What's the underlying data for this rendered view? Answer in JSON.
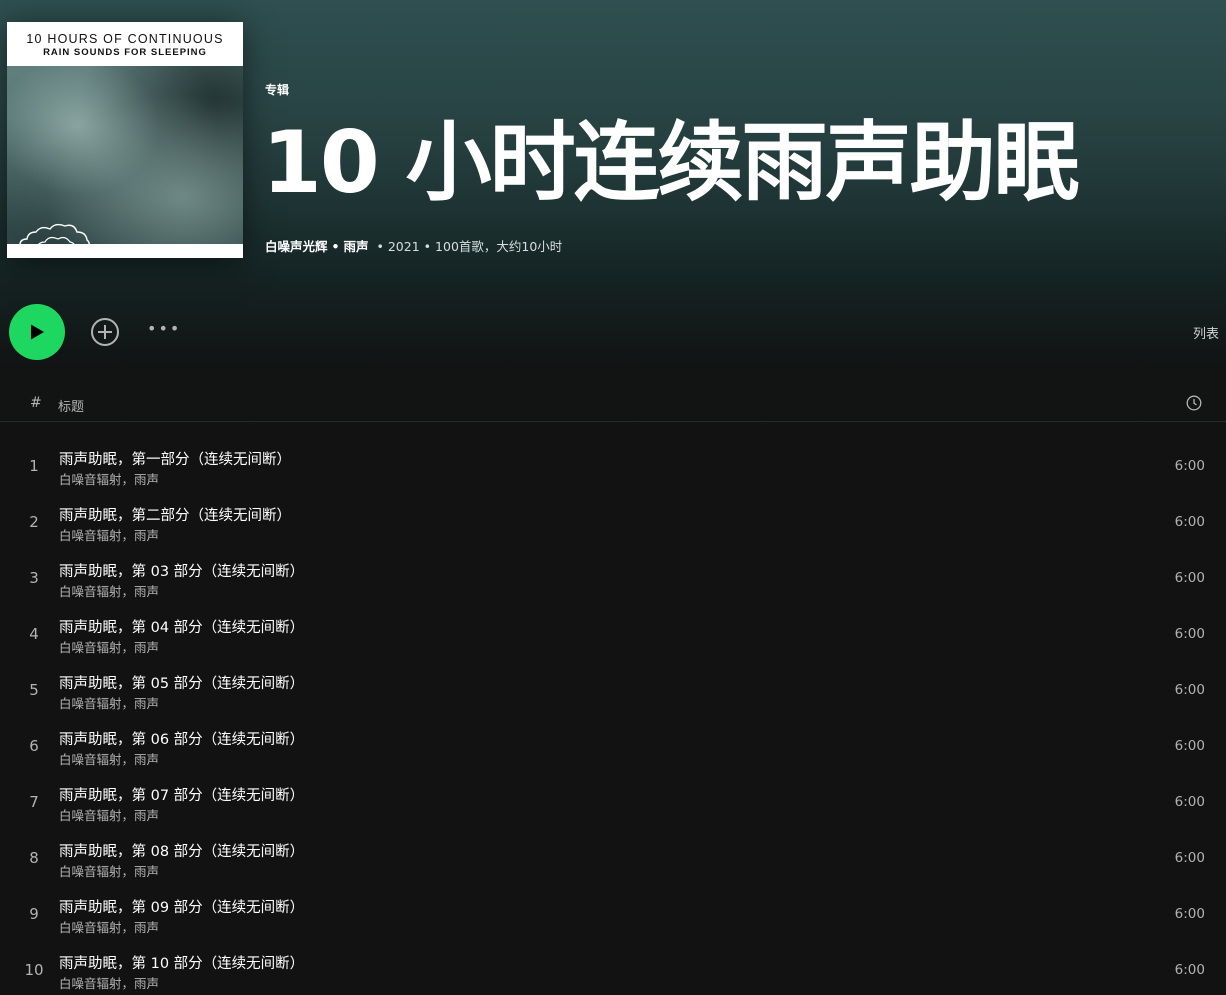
{
  "album": {
    "cover_line1": "10 HOURS OF CONTINUOUS",
    "cover_line2": "RAIN SOUNDS FOR SLEEPING",
    "type_label": "专辑",
    "title": "10 小时连续雨声助眠",
    "artist": "白噪声光辉",
    "separator": "•",
    "artist2": "雨声",
    "year": "2021",
    "track_count": "100首歌，大约10小时"
  },
  "actions": {
    "more_label": "•••",
    "view_label": "列表"
  },
  "table": {
    "hash_header": "#",
    "title_header": "标题"
  },
  "tracks": [
    {
      "num": "1",
      "title": "雨声助眠，第一部分（连续无间断）",
      "artist": "白噪音辐射，雨声",
      "duration": "6:00"
    },
    {
      "num": "2",
      "title": "雨声助眠，第二部分（连续无间断）",
      "artist": "白噪音辐射，雨声",
      "duration": "6:00"
    },
    {
      "num": "3",
      "title": "雨声助眠，第 03 部分（连续无间断）",
      "artist": "白噪音辐射，雨声",
      "duration": "6:00"
    },
    {
      "num": "4",
      "title": "雨声助眠，第 04 部分（连续无间断）",
      "artist": "白噪音辐射，雨声",
      "duration": "6:00"
    },
    {
      "num": "5",
      "title": "雨声助眠，第 05 部分（连续无间断）",
      "artist": "白噪音辐射，雨声",
      "duration": "6:00"
    },
    {
      "num": "6",
      "title": "雨声助眠，第 06 部分（连续无间断）",
      "artist": "白噪音辐射，雨声",
      "duration": "6:00"
    },
    {
      "num": "7",
      "title": "雨声助眠，第 07 部分（连续无间断）",
      "artist": "白噪音辐射，雨声",
      "duration": "6:00"
    },
    {
      "num": "8",
      "title": "雨声助眠，第 08 部分（连续无间断）",
      "artist": "白噪音辐射，雨声",
      "duration": "6:00"
    },
    {
      "num": "9",
      "title": "雨声助眠，第 09 部分（连续无间断）",
      "artist": "白噪音辐射，雨声",
      "duration": "6:00"
    },
    {
      "num": "10",
      "title": "雨声助眠，第 10 部分（连续无间断）",
      "artist": "白噪音辐射，雨声",
      "duration": "6:00"
    }
  ],
  "colors": {
    "accent": "#1ed760",
    "background": "#121212",
    "hero_top": "#2f4f50"
  },
  "icons": {
    "play": "play-icon",
    "add": "add-circle-icon",
    "more": "more-icon",
    "clock": "clock-icon",
    "cloud": "cloud-icon"
  }
}
